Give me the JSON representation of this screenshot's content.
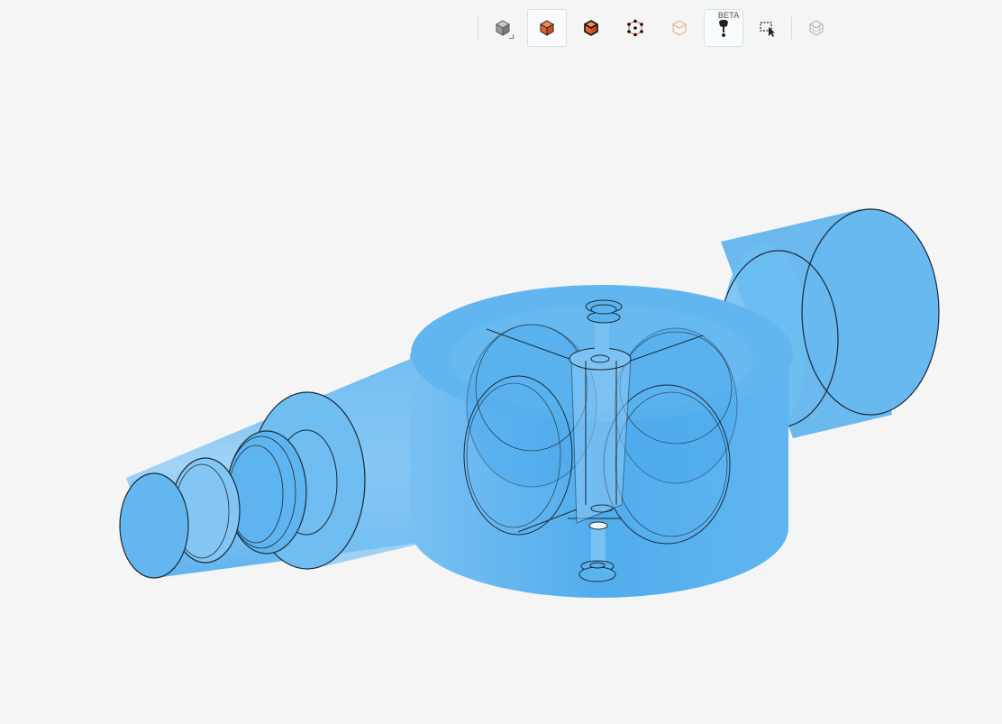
{
  "toolbar": {
    "buttons": [
      {
        "name": "view-cube-button",
        "icon": "gray-cube-icon",
        "active": false
      },
      {
        "name": "solid-view-button",
        "icon": "solid-cube-icon",
        "active": true
      },
      {
        "name": "edges-view-button",
        "icon": "cube-edges-icon",
        "active": false
      },
      {
        "name": "vertices-view-button",
        "icon": "cube-vertices-icon",
        "active": false
      },
      {
        "name": "transparent-view-button",
        "icon": "transparent-cube-icon",
        "active": false
      },
      {
        "name": "pin-probe-button",
        "icon": "pin-icon",
        "active": true,
        "badge": "BETA"
      },
      {
        "name": "box-select-button",
        "icon": "box-select-icon",
        "active": false
      },
      {
        "name": "mesh-view-button",
        "icon": "mesh-cube-icon",
        "active": false
      }
    ],
    "beta_label": "BETA"
  },
  "colors": {
    "model_fill": "#4aa9ec",
    "accent_orange": "#e8612c",
    "background": "#f5f5f5"
  }
}
